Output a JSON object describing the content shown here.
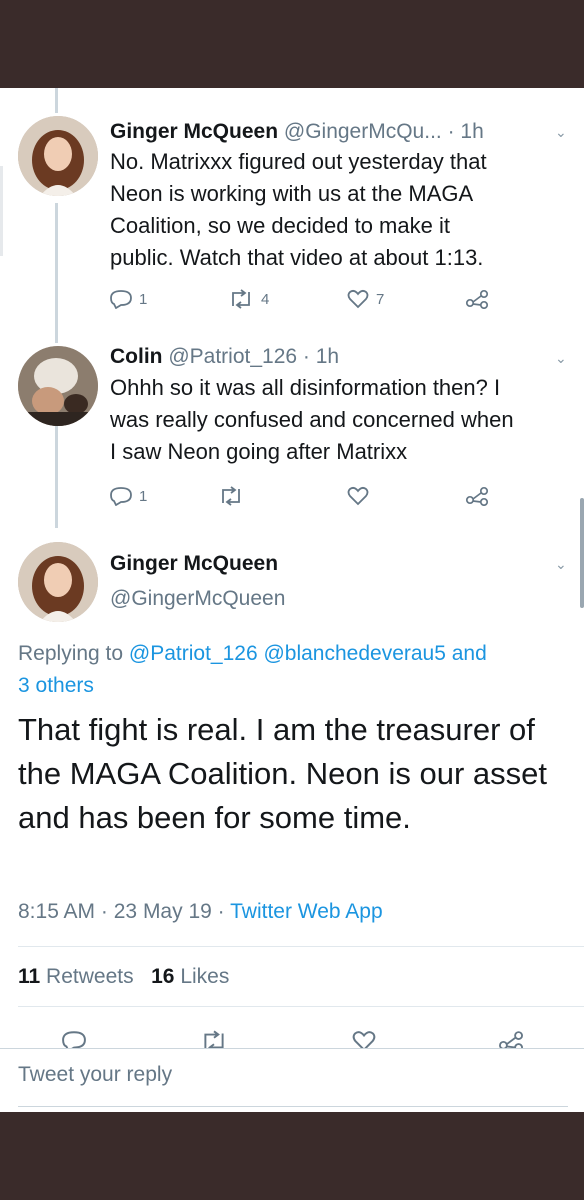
{
  "tweets": [
    {
      "name": "Ginger McQueen",
      "handle": "@GingerMcQu...",
      "time": "· 1h",
      "text_lines": [
        "No. Matrixxx figured out yesterday that",
        "Neon is working with us at the MAGA",
        "Coalition, so we decided to make it",
        "public. Watch that video at about 1:13."
      ],
      "reply_count": "1",
      "retweet_count": "4",
      "like_count": "7"
    },
    {
      "name": "Colin",
      "handle": "@Patriot_126",
      "time": "· 1h",
      "text_lines": [
        "Ohhh so it was all disinformation then? I",
        "was really confused and concerned when",
        "I saw Neon going after Matrixx"
      ],
      "reply_count": "1",
      "retweet_count": "",
      "like_count": ""
    }
  ],
  "focused_tweet": {
    "name": "Ginger McQueen",
    "handle": "@GingerMcQueen",
    "replying_prefix": "Replying to",
    "replying_handles": "@Patriot_126 @blanchedeverau5 and",
    "replying_others": "3 others",
    "text": "That fight is real. I am the treasurer of the MAGA Coalition. Neon is our asset and has been for some time.",
    "time": "8:15 AM",
    "date": "23 May 19",
    "source": "Twitter Web App",
    "retweets_count": "11",
    "retweets_label": "Retweets",
    "likes_count": "16",
    "likes_label": "Likes"
  },
  "reply_placeholder": "Tweet your reply",
  "icons": [
    "reply-icon",
    "retweet-icon",
    "like-icon",
    "share-icon",
    "chevron-down-icon"
  ],
  "colors": {
    "link": "#1b95e0",
    "secondary_text": "#657786",
    "primary_text": "#14171a",
    "frame": "#3a2b2a"
  }
}
